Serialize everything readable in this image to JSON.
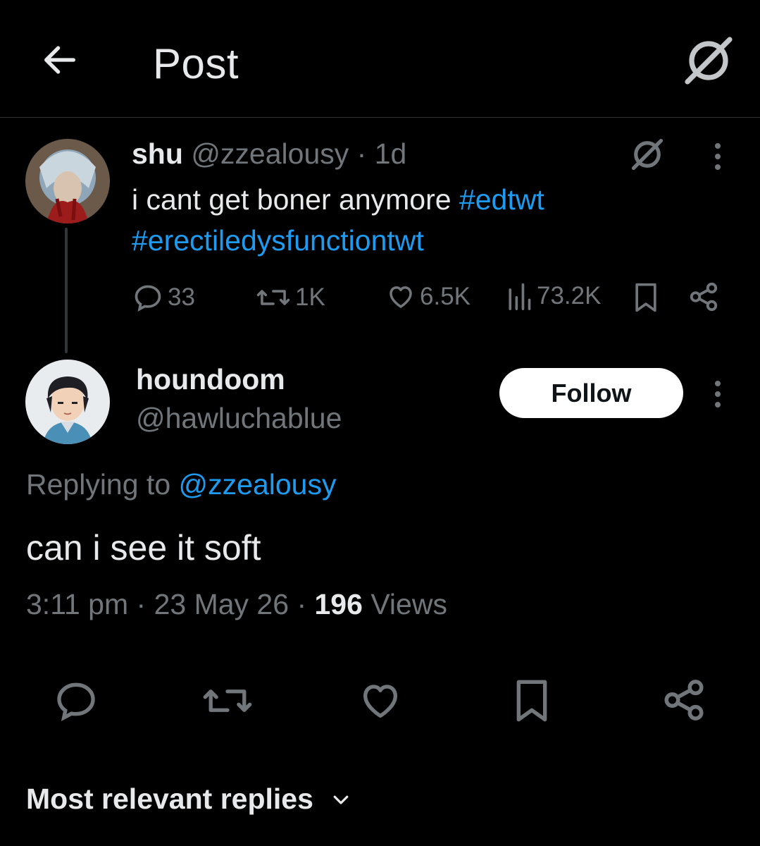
{
  "header": {
    "title": "Post",
    "back_icon": "arrow-left-icon",
    "grok_icon": "grok-icon"
  },
  "parent_post": {
    "display_name": "shu",
    "handle": "@zzealousy",
    "separator": "·",
    "time": "1d",
    "text_plain": "i cant get  boner anymore ",
    "hashtag_1": "#edtwt",
    "hashtag_2": "#erectiledysfunctiontwt",
    "stats": {
      "replies": "33",
      "reposts": "1K",
      "likes": "6.5K",
      "views": "73.2K"
    }
  },
  "reply_post": {
    "display_name": "houndoom",
    "handle": "@hawluchablue",
    "follow_label": "Follow",
    "replying_prefix": "Replying to ",
    "replying_handle": "@zzealousy",
    "text": "can i see it soft",
    "time": "3:11 pm",
    "date": "23 May 26",
    "separator": "·",
    "views_count": "196",
    "views_label": "Views"
  },
  "sort": {
    "label": "Most relevant replies"
  },
  "colors": {
    "background": "#000000",
    "text": "#e7e9ea",
    "muted": "#71767b",
    "link": "#1d9bf0",
    "follow_bg": "#ffffff"
  }
}
